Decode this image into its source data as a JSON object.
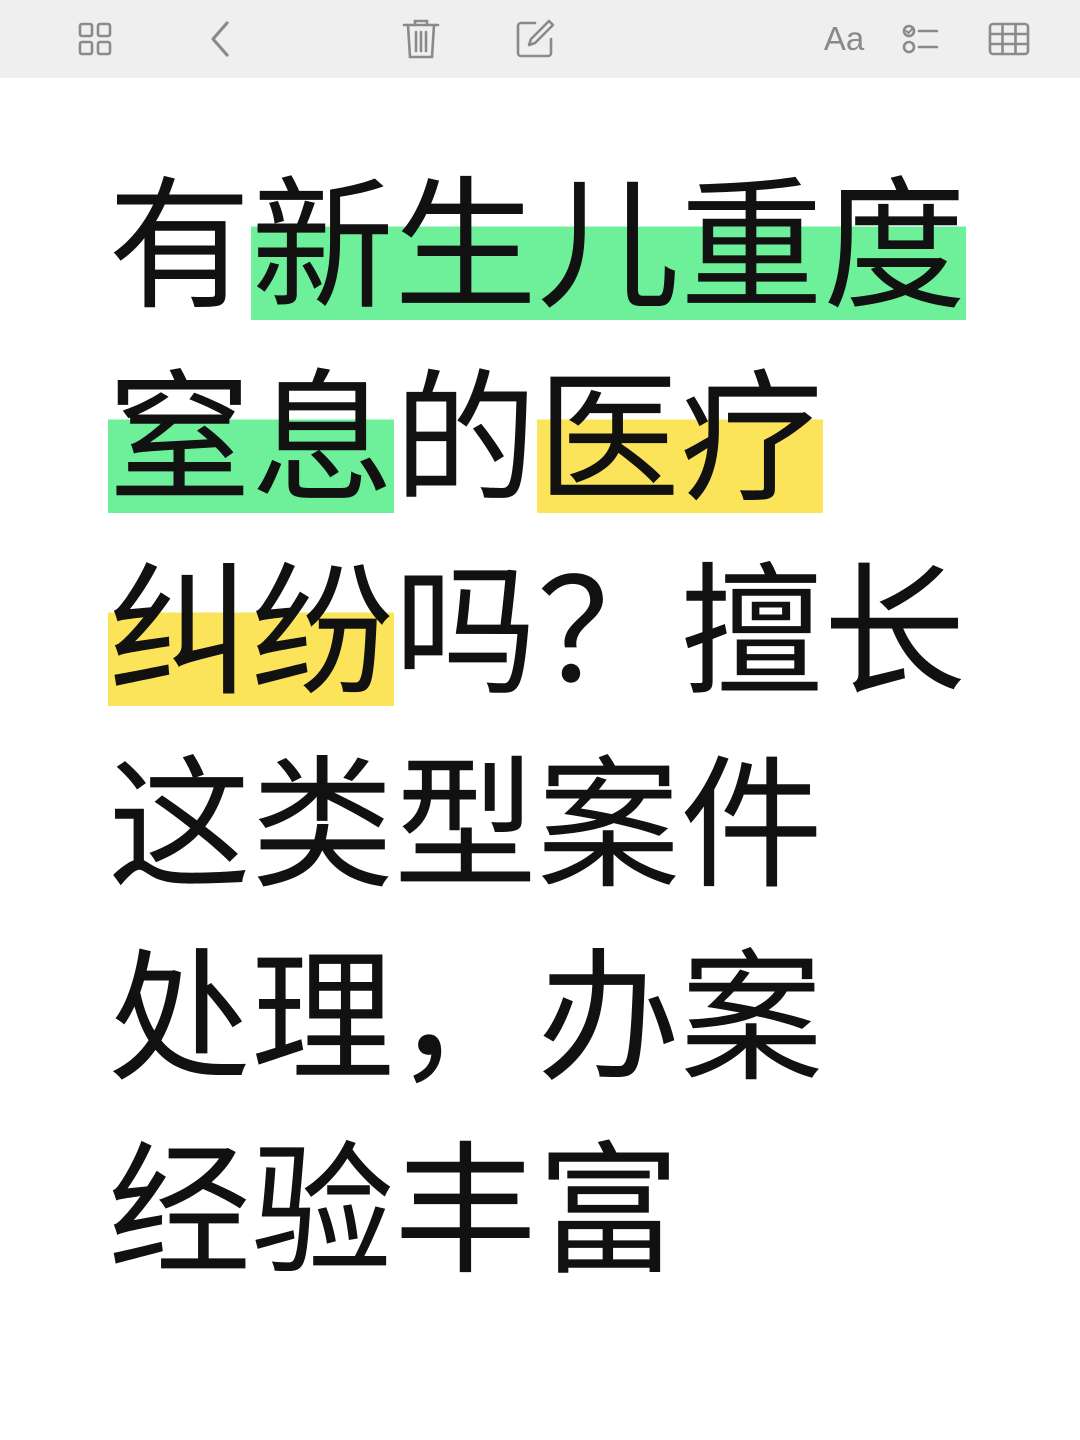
{
  "toolbar": {
    "buttons": [
      {
        "name": "gallery-view-icon"
      },
      {
        "name": "back-chevron-icon"
      },
      {
        "name": "trash-icon"
      },
      {
        "name": "compose-icon"
      },
      {
        "name": "format-text-button",
        "label": "Aa"
      },
      {
        "name": "checklist-icon"
      },
      {
        "name": "table-icon"
      }
    ],
    "icon_color": "#8a8a8a"
  },
  "note": {
    "lines": [
      [
        {
          "text": "有",
          "highlight": ""
        },
        {
          "text": "新生儿重度",
          "highlight": "green"
        }
      ],
      [
        {
          "text": "窒息",
          "highlight": "green"
        },
        {
          "text": "的",
          "highlight": ""
        },
        {
          "text": "医疗",
          "highlight": "yellow"
        }
      ],
      [
        {
          "text": "纠纷",
          "highlight": "yellow"
        },
        {
          "text": "吗？擅长",
          "highlight": ""
        }
      ],
      [
        {
          "text": "这类型案件",
          "highlight": ""
        }
      ],
      [
        {
          "text": "处理，办案",
          "highlight": ""
        }
      ],
      [
        {
          "text": "经验丰富",
          "highlight": ""
        }
      ]
    ],
    "highlight_colors": {
      "green": "#6ef09a",
      "yellow": "#fbe35a"
    }
  }
}
